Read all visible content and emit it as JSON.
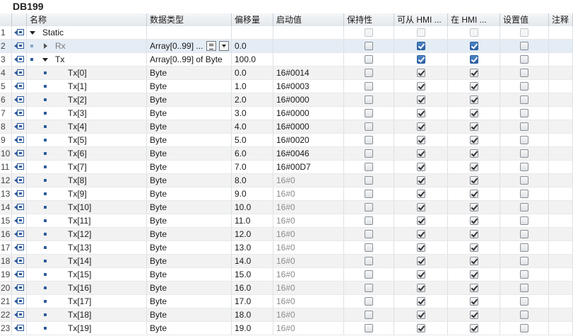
{
  "window": {
    "title": "DB199"
  },
  "columns": {
    "name": "名称",
    "datatype": "数据类型",
    "offset": "偏移量",
    "start": "启动值",
    "retain": "保持性",
    "hmi_access": "可从 HMI ...",
    "hmi_visible": "在 HMI ...",
    "setpoint": "设置值",
    "comment": "注释"
  },
  "rows": [
    {
      "num": "1",
      "name": "Static",
      "type": "",
      "offset": "",
      "start": "",
      "level": 0,
      "expander": "down"
    },
    {
      "num": "2",
      "name": "Rx",
      "type": "Array[0..99] ...",
      "offset": "0.0",
      "start": "",
      "level": 1,
      "expander": "right",
      "selected": true
    },
    {
      "num": "3",
      "name": "Tx",
      "type": "Array[0..99] of Byte",
      "offset": "100.0",
      "start": "",
      "level": 1,
      "expander": "down"
    },
    {
      "num": "4",
      "name": "Tx[0]",
      "type": "Byte",
      "offset": "0.0",
      "start": "16#0014",
      "level": 2
    },
    {
      "num": "5",
      "name": "Tx[1]",
      "type": "Byte",
      "offset": "1.0",
      "start": "16#0003",
      "level": 2
    },
    {
      "num": "6",
      "name": "Tx[2]",
      "type": "Byte",
      "offset": "2.0",
      "start": "16#0000",
      "level": 2
    },
    {
      "num": "7",
      "name": "Tx[3]",
      "type": "Byte",
      "offset": "3.0",
      "start": "16#0000",
      "level": 2
    },
    {
      "num": "8",
      "name": "Tx[4]",
      "type": "Byte",
      "offset": "4.0",
      "start": "16#0000",
      "level": 2
    },
    {
      "num": "9",
      "name": "Tx[5]",
      "type": "Byte",
      "offset": "5.0",
      "start": "16#0020",
      "level": 2
    },
    {
      "num": "10",
      "name": "Tx[6]",
      "type": "Byte",
      "offset": "6.0",
      "start": "16#0046",
      "level": 2
    },
    {
      "num": "11",
      "name": "Tx[7]",
      "type": "Byte",
      "offset": "7.0",
      "start": "16#00D7",
      "level": 2
    },
    {
      "num": "12",
      "name": "Tx[8]",
      "type": "Byte",
      "offset": "8.0",
      "start": "16#0",
      "level": 2,
      "default": true
    },
    {
      "num": "13",
      "name": "Tx[9]",
      "type": "Byte",
      "offset": "9.0",
      "start": "16#0",
      "level": 2,
      "default": true
    },
    {
      "num": "14",
      "name": "Tx[10]",
      "type": "Byte",
      "offset": "10.0",
      "start": "16#0",
      "level": 2,
      "default": true
    },
    {
      "num": "15",
      "name": "Tx[11]",
      "type": "Byte",
      "offset": "11.0",
      "start": "16#0",
      "level": 2,
      "default": true
    },
    {
      "num": "16",
      "name": "Tx[12]",
      "type": "Byte",
      "offset": "12.0",
      "start": "16#0",
      "level": 2,
      "default": true
    },
    {
      "num": "17",
      "name": "Tx[13]",
      "type": "Byte",
      "offset": "13.0",
      "start": "16#0",
      "level": 2,
      "default": true
    },
    {
      "num": "18",
      "name": "Tx[14]",
      "type": "Byte",
      "offset": "14.0",
      "start": "16#0",
      "level": 2,
      "default": true
    },
    {
      "num": "19",
      "name": "Tx[15]",
      "type": "Byte",
      "offset": "15.0",
      "start": "16#0",
      "level": 2,
      "default": true
    },
    {
      "num": "20",
      "name": "Tx[16]",
      "type": "Byte",
      "offset": "16.0",
      "start": "16#0",
      "level": 2,
      "default": true
    },
    {
      "num": "21",
      "name": "Tx[17]",
      "type": "Byte",
      "offset": "17.0",
      "start": "16#0",
      "level": 2,
      "default": true
    },
    {
      "num": "22",
      "name": "Tx[18]",
      "type": "Byte",
      "offset": "18.0",
      "start": "16#0",
      "level": 2,
      "default": true
    },
    {
      "num": "23",
      "name": "Tx[19]",
      "type": "Byte",
      "offset": "19.0",
      "start": "16#0",
      "level": 2,
      "default": true
    }
  ]
}
